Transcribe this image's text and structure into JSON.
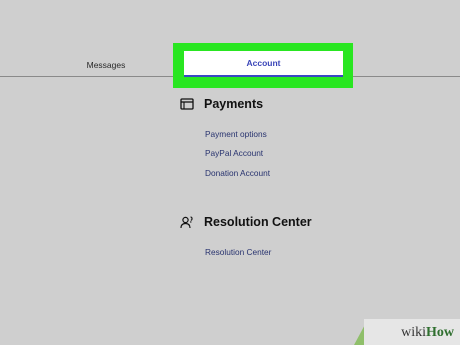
{
  "tabs": {
    "messages_label": "Messages",
    "account_label": "Account",
    "highlight_color": "#29e621",
    "active_color": "#3a47c4"
  },
  "payments": {
    "title": "Payments",
    "icon": "card-icon",
    "links": [
      "Payment options",
      "PayPal Account",
      "Donation Account"
    ]
  },
  "resolution": {
    "title": "Resolution Center",
    "icon": "person-help-icon",
    "links": [
      "Resolution Center"
    ]
  },
  "watermark": {
    "prefix": "wiki",
    "suffix": "How"
  }
}
